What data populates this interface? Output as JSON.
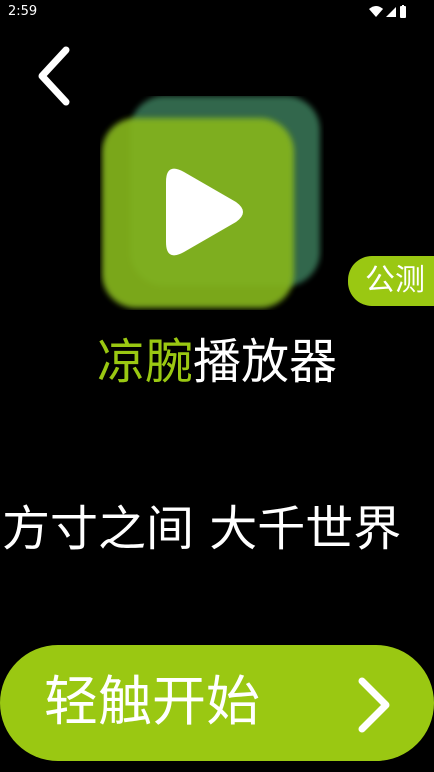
{
  "status_bar": {
    "time": "2:59",
    "icons": [
      "wifi-icon",
      "cell-signal-icon",
      "battery-icon"
    ]
  },
  "header": {
    "back_icon": "chevron-left-icon"
  },
  "logo": {
    "icon": "play-icon",
    "colors": {
      "front": "#84b41c",
      "back": "#3a7a5a"
    }
  },
  "badge": {
    "label": "公测"
  },
  "title": {
    "accent": "凉腕",
    "rest": "播放器"
  },
  "slogan": {
    "text": "方寸之间  大千世界"
  },
  "start_button": {
    "label": "轻触开始",
    "icon": "chevron-right-icon"
  },
  "colors": {
    "accent": "#9ac812",
    "background": "#000000",
    "text": "#ffffff"
  }
}
